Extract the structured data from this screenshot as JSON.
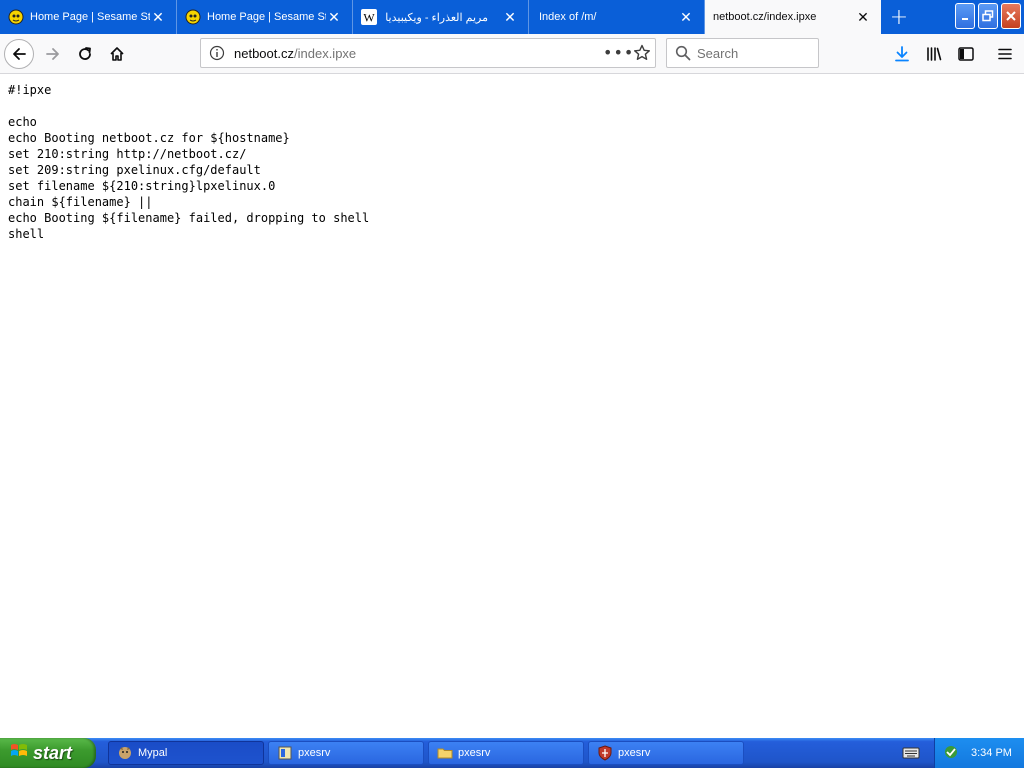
{
  "browser": {
    "tabs": [
      {
        "title": "Home Page | Sesame St",
        "favicon": "sesame-icon",
        "active": false
      },
      {
        "title": "Home Page | Sesame St",
        "favicon": "sesame-icon",
        "active": false
      },
      {
        "title": "مريم العذراء - ويكيبيديا",
        "favicon": "wikipedia-icon",
        "active": false
      },
      {
        "title": "Index of /m/",
        "favicon": "",
        "active": false
      },
      {
        "title": "netboot.cz/index.ipxe",
        "favicon": "",
        "active": true
      }
    ],
    "new_tab_label": "+",
    "url": {
      "host": "netboot.cz",
      "path": "/index.ipxe"
    },
    "search": {
      "placeholder": "Search",
      "value": ""
    }
  },
  "page": {
    "lines": [
      "#!ipxe",
      "",
      "echo",
      "echo Booting netboot.cz for ${hostname}",
      "set 210:string http://netboot.cz/",
      "set 209:string pxelinux.cfg/default",
      "set filename ${210:string}lpxelinux.0",
      "chain ${filename} ||",
      "echo Booting ${filename} failed, dropping to shell",
      "shell"
    ]
  },
  "taskbar": {
    "start_label": "start",
    "items": [
      {
        "label": "Mypal",
        "icon": "mypal-icon",
        "active": true
      },
      {
        "label": "pxesrv",
        "icon": "app-icon",
        "active": false
      },
      {
        "label": "pxesrv",
        "icon": "folder-icon",
        "active": false
      },
      {
        "label": "pxesrv",
        "icon": "shield-app-icon",
        "active": false
      }
    ],
    "clock": "3:34 PM"
  },
  "colors": {
    "tabstrip": "#0a5fd8",
    "taskbar": "#245edb",
    "start": "#3c9b2e"
  }
}
